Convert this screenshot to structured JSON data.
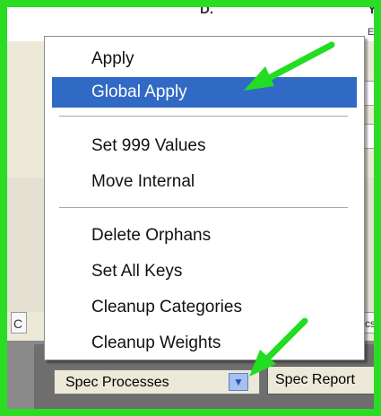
{
  "context_menu": {
    "items": [
      {
        "label": "Apply",
        "selected": false
      },
      {
        "label": "Global Apply",
        "selected": true
      },
      {
        "label": "Set 999 Values",
        "selected": false
      },
      {
        "label": "Move Internal",
        "selected": false
      },
      {
        "label": "Delete Orphans",
        "selected": false
      },
      {
        "label": "Set All Keys",
        "selected": false
      },
      {
        "label": "Cleanup Categories",
        "selected": false
      },
      {
        "label": "Cleanup Weights",
        "selected": false
      }
    ]
  },
  "background": {
    "header_fragment_a": "D.",
    "header_fragment_b": "Yo",
    "sub_fragment": "Ex",
    "tab_fragment_left": "C",
    "tab_fragment_right": "cs"
  },
  "bottom_bar": {
    "dropdown_value": "Spec Processes",
    "report_button_label": "Spec Report"
  },
  "annotations": {
    "arrow_color": "#22dd22",
    "frame_color": "#2bdc24"
  },
  "colors": {
    "selection": "#316ac5",
    "menu_background": "#ffffff"
  }
}
